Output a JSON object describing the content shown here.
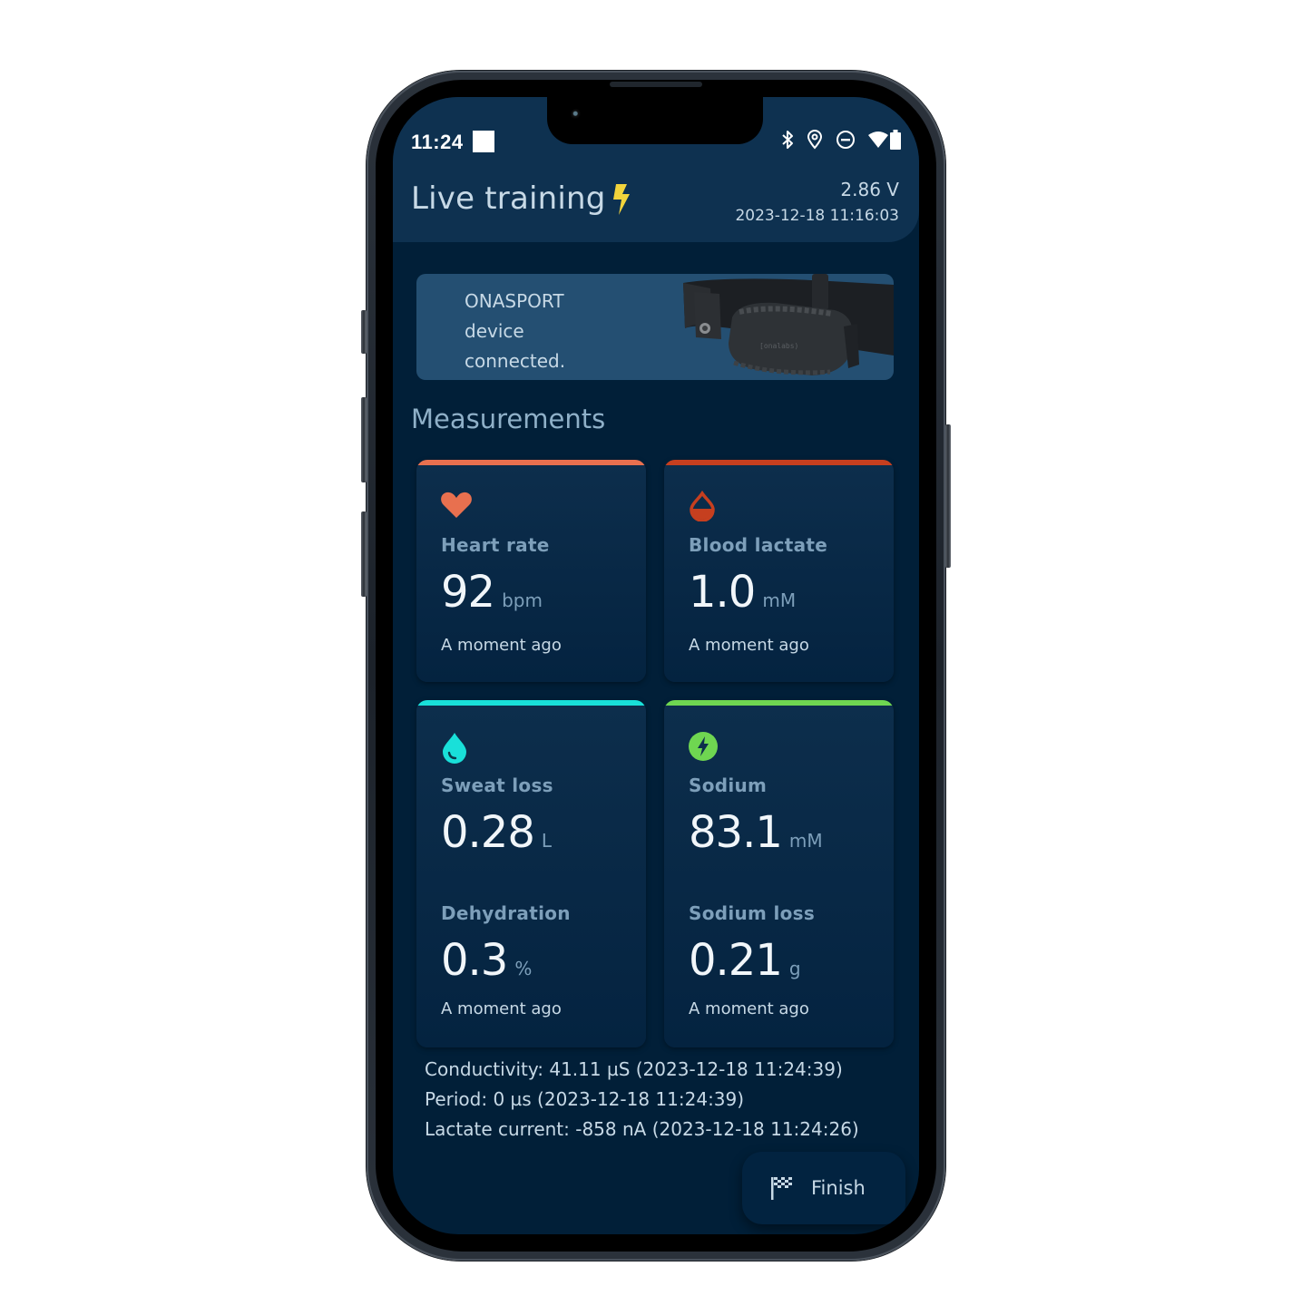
{
  "status_bar": {
    "time": "11:24",
    "icons": [
      "bluetooth-icon",
      "location-icon",
      "do-not-disturb-icon",
      "wifi-icon",
      "battery-icon"
    ]
  },
  "header": {
    "title": "Live training",
    "title_icon": "lightning-bolt-icon",
    "voltage": "2.86 V",
    "timestamp": "2023-12-18 11:16:03"
  },
  "device_banner": {
    "line1": "ONASPORT",
    "line2": "device",
    "line3": "connected.",
    "image": "chest-strap-sensor"
  },
  "measurements": {
    "section_title": "Measurements",
    "cards": [
      {
        "id": "heart-rate",
        "icon": "heart-icon",
        "accent": "#e8704f",
        "label": "Heart rate",
        "value": "92",
        "unit": "bpm",
        "updated": "A moment ago"
      },
      {
        "id": "blood-lactate",
        "icon": "blood-drop-icon",
        "accent": "#c63f1f",
        "label": "Blood lactate",
        "value": "1.0",
        "unit": "mM",
        "updated": "A moment ago"
      },
      {
        "id": "sweat",
        "icon": "water-drop-icon",
        "accent": "#19e0d9",
        "label": "Sweat loss",
        "value": "0.28",
        "unit": "L",
        "label2": "Dehydration",
        "value2": "0.3",
        "unit2": "%",
        "updated": "A moment ago"
      },
      {
        "id": "sodium",
        "icon": "electrolyte-bolt-icon",
        "accent": "#6fd651",
        "label": "Sodium",
        "value": "83.1",
        "unit": "mM",
        "label2": "Sodium loss",
        "value2": "0.21",
        "unit2": "g",
        "updated": "A moment ago"
      }
    ]
  },
  "raw_readings": [
    "Conductivity: 41.11 µS (2023-12-18 11:24:39)",
    "Period: 0 µs (2023-12-18 11:24:39)",
    "Lactate current: -858 nA (2023-12-18 11:24:26)"
  ],
  "finish_button": {
    "label": "Finish",
    "icon": "checkered-flag-icon"
  },
  "colors": {
    "background": "#011f38",
    "header": "#0e3150",
    "banner": "#244f72",
    "text_primary": "#c7d9e6",
    "text_muted": "#7d9fba",
    "bolt_yellow": "#f2d43c"
  }
}
